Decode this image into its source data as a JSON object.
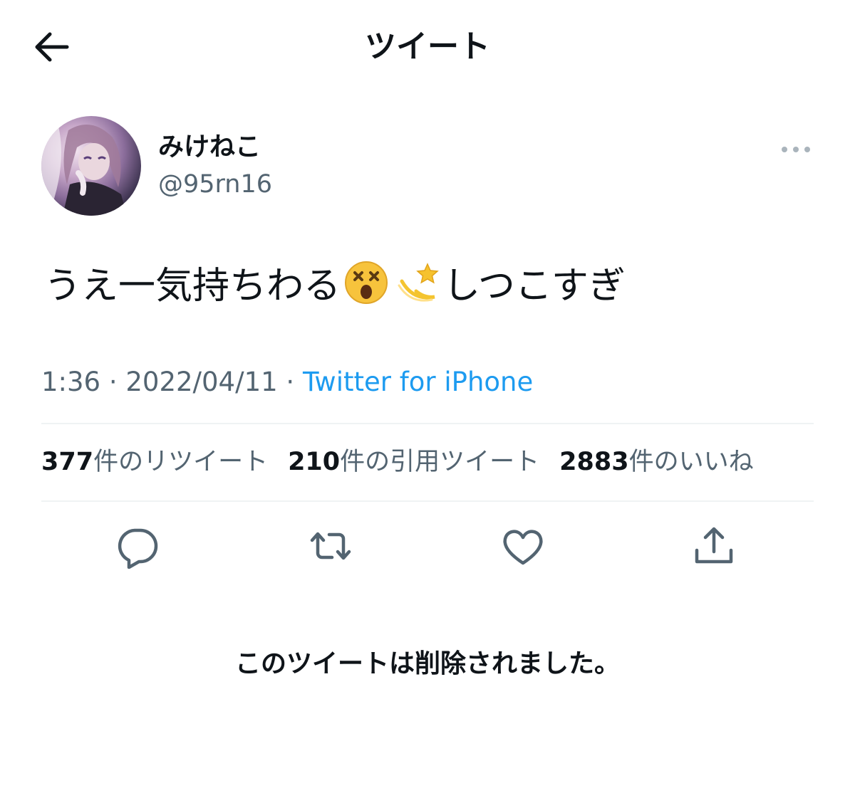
{
  "header": {
    "title": "ツイート",
    "back_icon": "arrow-left-icon"
  },
  "author": {
    "display_name": "みけねこ",
    "handle": "@95rn16",
    "avatar": "avatar-image",
    "more_icon": "more-dots-icon"
  },
  "tweet": {
    "text_before": "うえ一気持ちわる",
    "emojis": [
      "dizzy-face-emoji",
      "dizzy-star-emoji"
    ],
    "text_after": "しつこすぎ",
    "time": "1:36",
    "separator": "·",
    "date": "2022/04/11",
    "source": "Twitter for iPhone"
  },
  "stats": {
    "retweets_count": "377",
    "retweets_label": "件のリツイート",
    "quotes_count": "210",
    "quotes_label": "件の引用ツイート",
    "likes_count": "2883",
    "likes_label": "件のいいね"
  },
  "actions": [
    "reply-icon",
    "retweet-icon",
    "like-icon",
    "share-icon"
  ],
  "notice": {
    "deleted": "このツイートは削除されました。"
  },
  "colors": {
    "text": "#0f1419",
    "secondary": "#536471",
    "link": "#1d9bf0",
    "divider": "#eff3f4"
  }
}
